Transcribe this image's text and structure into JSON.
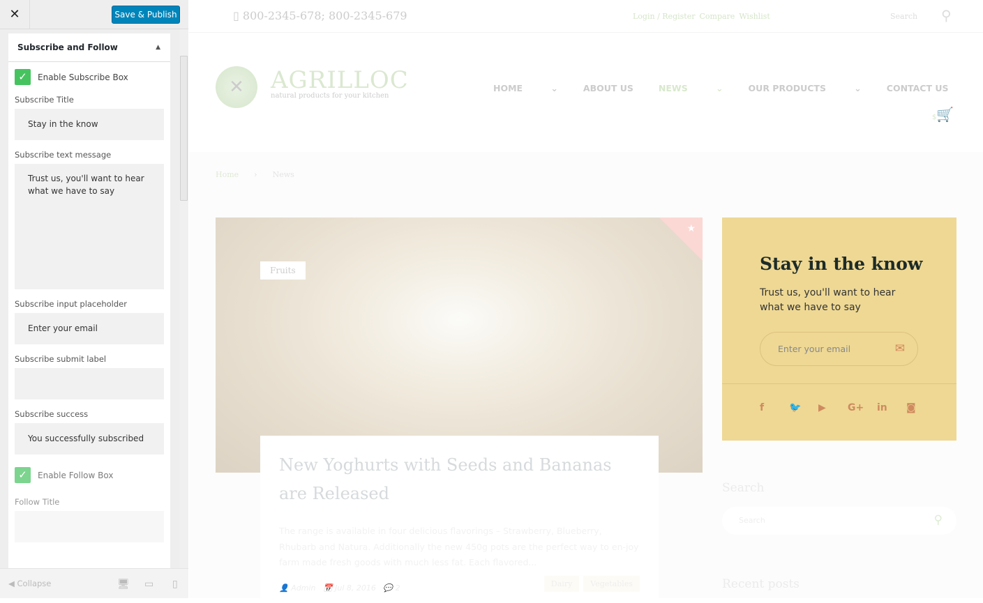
{
  "customizer": {
    "close_label": "✕",
    "save_label": "Save & Publish",
    "section_title": "Subscribe and Follow",
    "enable_subscribe": "Enable Subscribe Box",
    "subscribe_title_label": "Subscribe Title",
    "subscribe_title_value": "Stay in the know",
    "subscribe_text_label": "Subscribe text message",
    "subscribe_text_value": "Trust us, you'll want to hear what we have to say",
    "placeholder_label": "Subscribe input placeholder",
    "placeholder_value": "Enter your email",
    "submit_label": "Subscribe submit label",
    "submit_value": "",
    "success_label": "Subscribe success",
    "success_value": "You successfully subscribed",
    "enable_follow": "Enable Follow Box",
    "follow_title_label": "Follow Title",
    "follow_title_value": "",
    "collapse": "Collapse"
  },
  "site": {
    "phones": "800-2345-678;  800-2345-679",
    "login": "Login / Register",
    "compare": "Compare",
    "wishlist": "Wishlist",
    "search": "Search",
    "brand": "AGRILLOC",
    "tagline": "natural products for your kitchen",
    "cart_count": "$",
    "nav": [
      "HOME",
      "ABOUT US",
      "NEWS",
      "OUR PRODUCTS",
      "CONTACT US"
    ],
    "breadcrumb": [
      "Home",
      "›",
      "News"
    ],
    "post": {
      "category": "Fruits",
      "title": "New Yoghurts with Seeds and Bananas are Released",
      "excerpt": "The range is available in four delicious flavorings – Strawberry, Blueberry, Rhubarb and Natura. Additionally the new 450g pots are the perfect way to en-joy farm made fresh goods with much less fat. Each flavored...",
      "author": "Admin",
      "date": "Jul 8, 2016",
      "comments": "2",
      "tags": [
        "Dairy",
        "Vegetables"
      ]
    },
    "subscribe": {
      "title": "Stay in the know",
      "text": "Trust us, you'll want to hear what we have to say",
      "placeholder": "Enter your email"
    },
    "search_widget": {
      "title": "Search",
      "placeholder": "Search"
    },
    "recent_posts": "Recent posts"
  },
  "colors": {
    "accent": "#0085ba",
    "check": "#46c35f",
    "subscribe_bg": "#eed894",
    "social": "#cf8a5e"
  }
}
